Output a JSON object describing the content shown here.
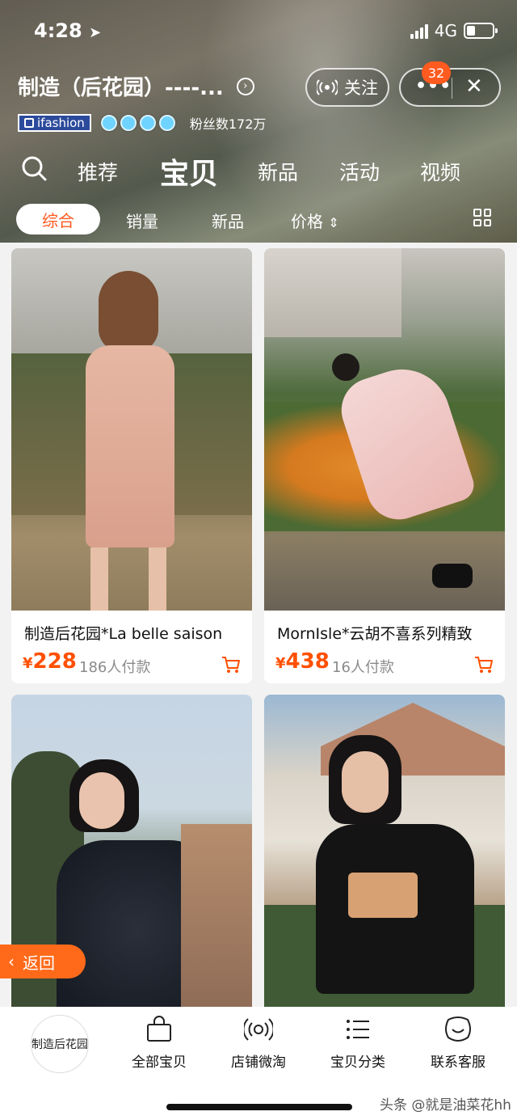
{
  "status": {
    "time": "4:28",
    "network": "4G"
  },
  "header": {
    "shop_name": "制造（后花园）----...",
    "follow_label": "关注",
    "more_label": "•••",
    "close_label": "✕",
    "badge_count": "32",
    "ifashion_label": "ifashion",
    "fans_text": "粉丝数172万"
  },
  "nav": {
    "tabs": [
      "推荐",
      "宝贝",
      "新品",
      "活动",
      "视频"
    ],
    "active": "宝贝"
  },
  "filters": {
    "items": [
      "综合",
      "销量",
      "新品",
      "价格"
    ],
    "active": "综合",
    "price_sort_icon": "⇕"
  },
  "products": [
    {
      "title": "制造后花园*La belle saison",
      "currency": "¥",
      "price": "228",
      "sold": "186人付款"
    },
    {
      "title": "MornIsle*云胡不喜系列精致",
      "currency": "¥",
      "price": "438",
      "sold": "16人付款"
    },
    {
      "title": "",
      "currency": "",
      "price": "",
      "sold": ""
    },
    {
      "title": "",
      "currency": "",
      "price": "",
      "sold": ""
    }
  ],
  "back_button": {
    "label": "返回"
  },
  "bottom_bar": {
    "shop_logo_text": "制造后花园",
    "items": [
      {
        "label": "全部宝贝",
        "icon": "bag-icon"
      },
      {
        "label": "店铺微淘",
        "icon": "broadcast-icon"
      },
      {
        "label": "宝贝分类",
        "icon": "list-icon"
      },
      {
        "label": "联系客服",
        "icon": "chat-face-icon"
      }
    ]
  },
  "watermark": "头条 @就是油菜花hh",
  "colors": {
    "accent": "#ff5a1f",
    "price": "#ff5000",
    "ifashion_blue": "#2c4a9c"
  }
}
